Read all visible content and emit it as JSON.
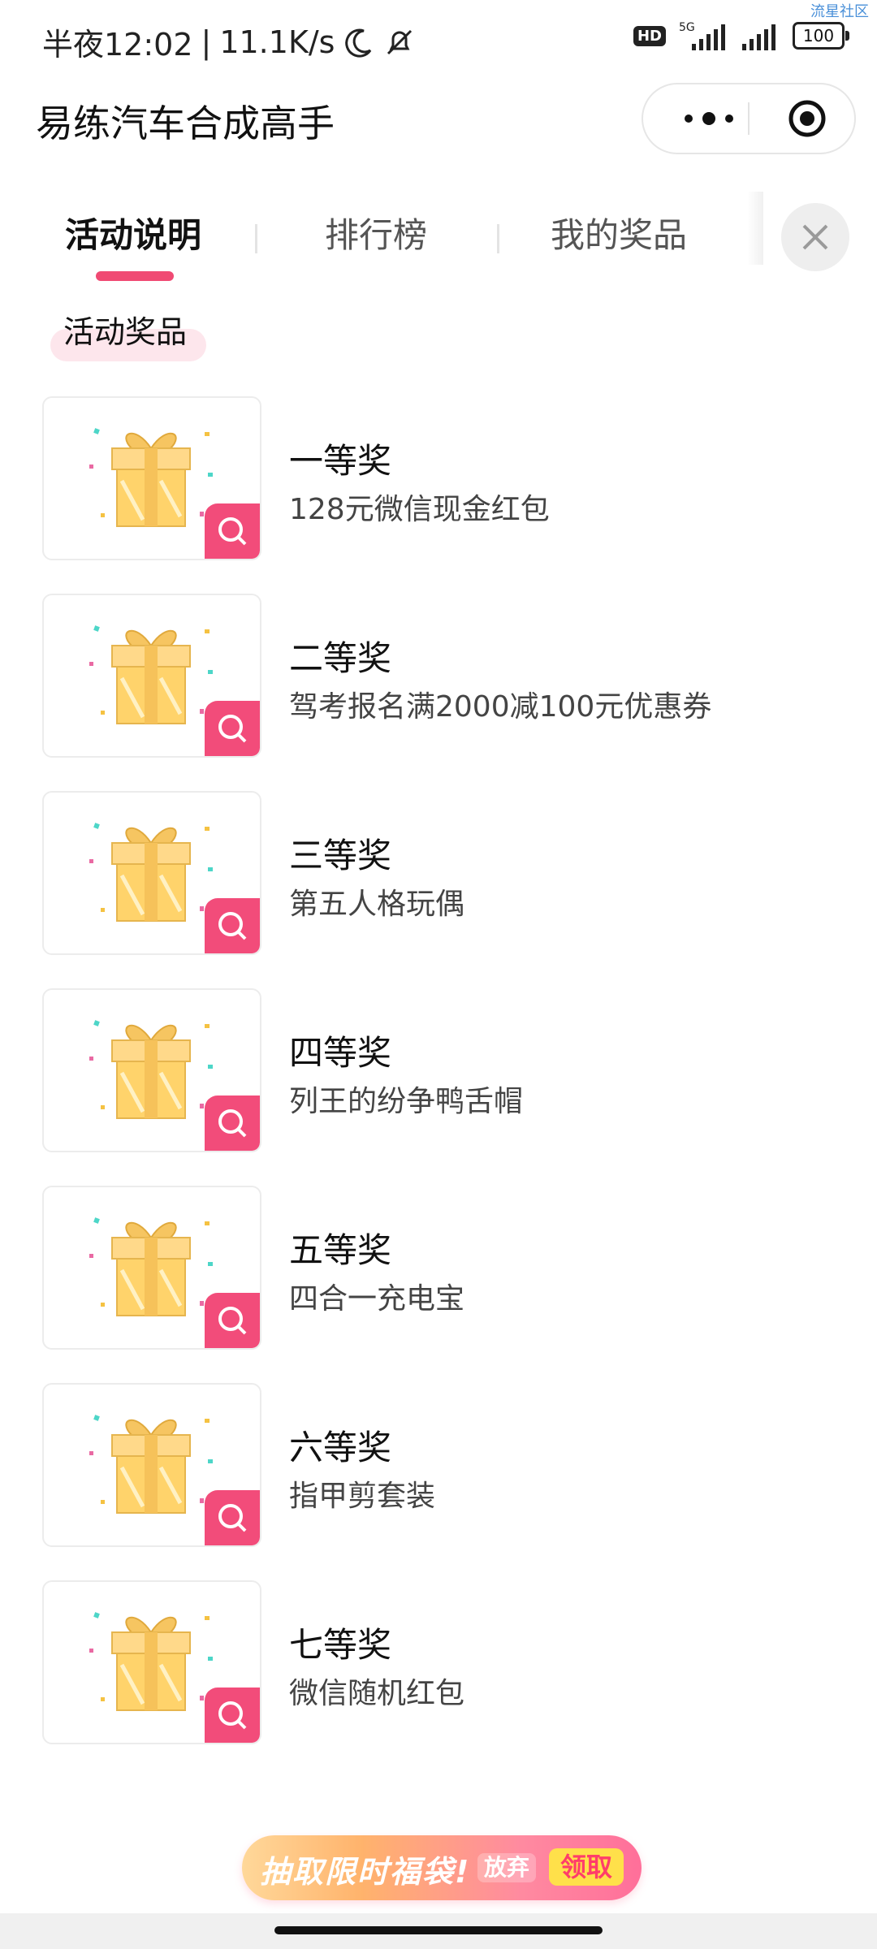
{
  "status_bar": {
    "time": "半夜12:02",
    "net_speed": "11.1K/s",
    "hd": "HD",
    "network": "5G",
    "battery": "100",
    "watermark": "流星社区"
  },
  "header": {
    "title": "易练汽车合成高手"
  },
  "tabs": [
    {
      "label": "活动说明",
      "active": true
    },
    {
      "label": "排行榜",
      "active": false
    },
    {
      "label": "我的奖品",
      "active": false
    }
  ],
  "section": {
    "title": "活动奖品"
  },
  "prizes": [
    {
      "name": "一等奖",
      "desc": "128元微信现金红包"
    },
    {
      "name": "二等奖",
      "desc": "驾考报名满2000减100元优惠券"
    },
    {
      "name": "三等奖",
      "desc": "第五人格玩偶"
    },
    {
      "name": "四等奖",
      "desc": "列王的纷争鸭舌帽"
    },
    {
      "name": "五等奖",
      "desc": "四合一充电宝"
    },
    {
      "name": "六等奖",
      "desc": "指甲剪套装"
    },
    {
      "name": "七等奖",
      "desc": "微信随机红包"
    }
  ],
  "banner": {
    "text": "抽取限时福袋!",
    "giveup": "放弃",
    "claim": "领取"
  },
  "colors": {
    "accent": "#f04a73",
    "zoom": "#f24c7a"
  },
  "icons": {
    "more": "more-dots-icon",
    "miniapp": "target-circle-icon",
    "close": "close-icon",
    "zoom": "zoom-icon",
    "gift": "gift-box-icon"
  }
}
